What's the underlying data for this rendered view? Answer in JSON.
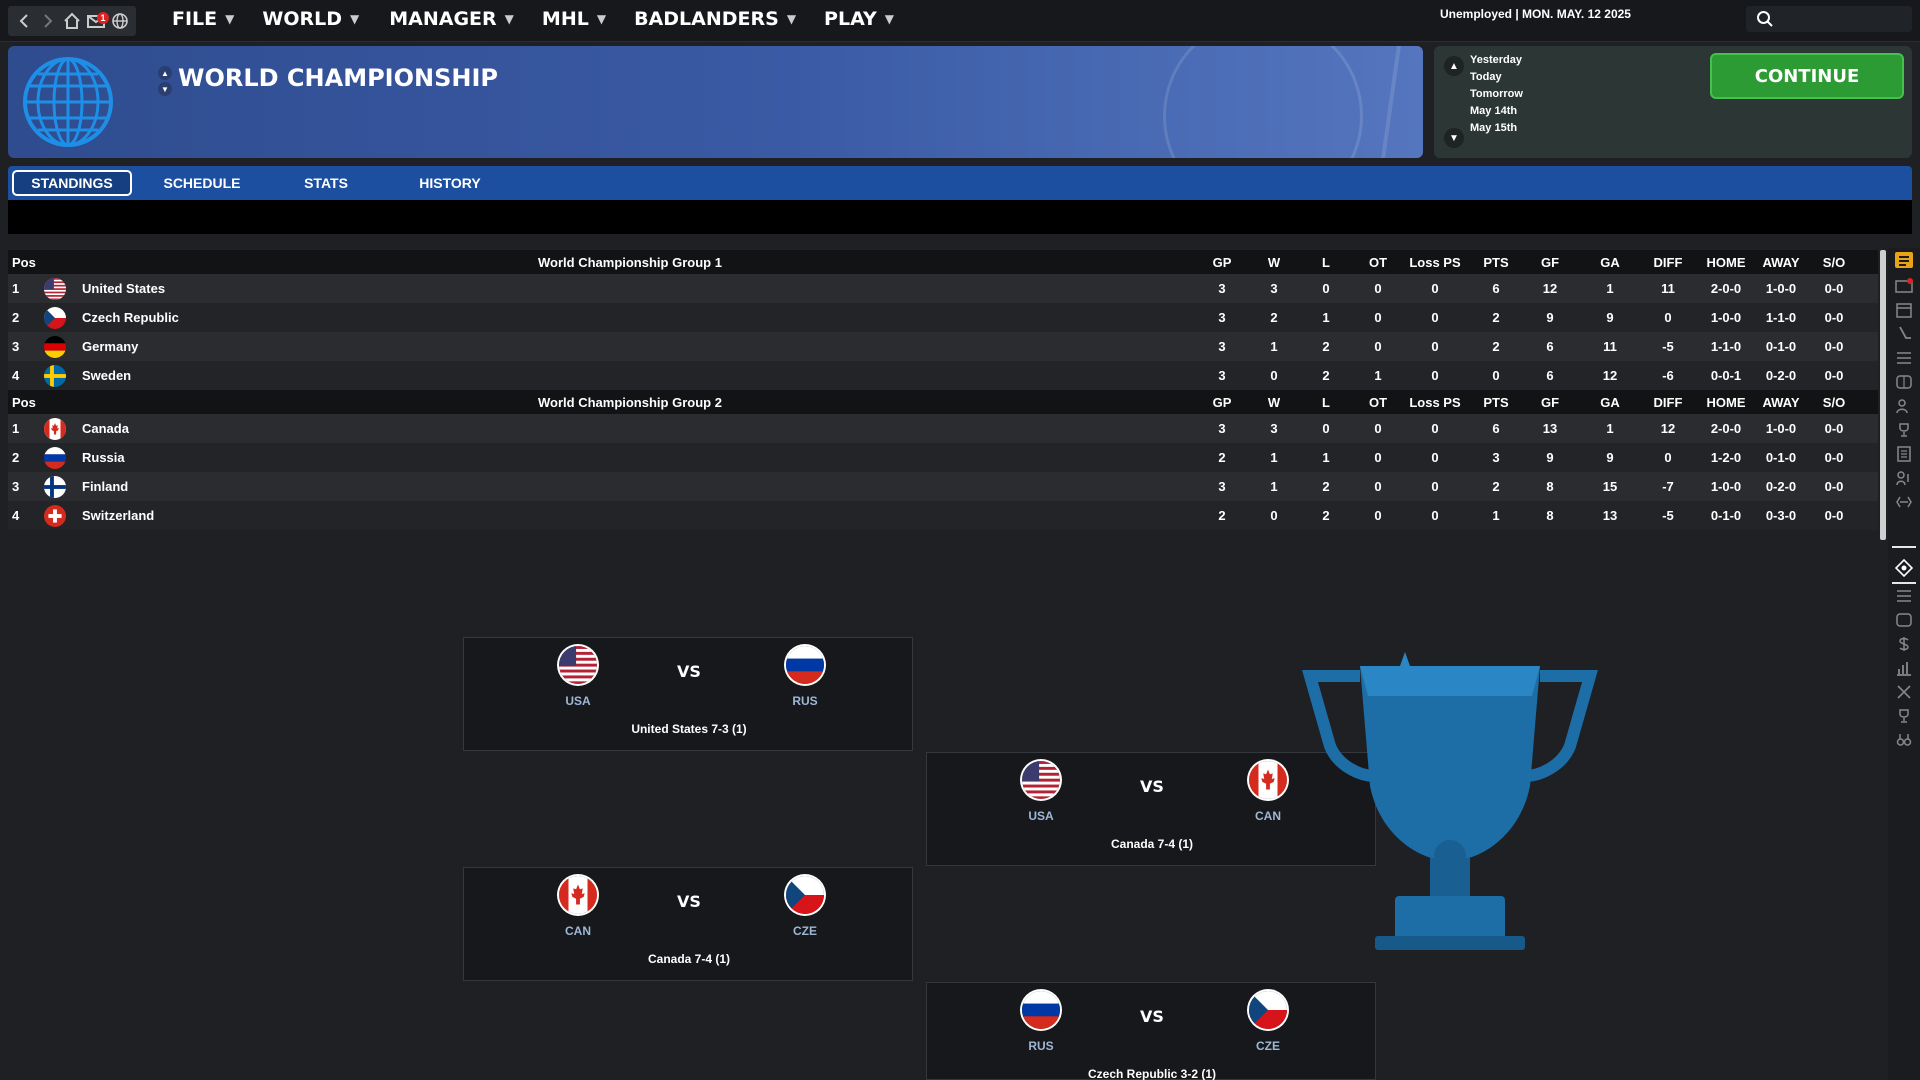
{
  "menu": [
    {
      "label": "FILE"
    },
    {
      "label": "WORLD"
    },
    {
      "label": "MANAGER"
    },
    {
      "label": "MHL"
    },
    {
      "label": "BADLANDERS"
    },
    {
      "label": "PLAY"
    }
  ],
  "status": "Unemployed | MON. MAY. 12 2025",
  "notifications": "1",
  "banner": {
    "title": "WORLD CHAMPIONSHIP"
  },
  "dates": [
    "Yesterday",
    "Today",
    "Tomorrow",
    "May 14th",
    "May 15th"
  ],
  "continue_label": "CONTINUE",
  "tabs": [
    "STANDINGS",
    "SCHEDULE",
    "STATS",
    "HISTORY"
  ],
  "columns": [
    "GP",
    "W",
    "L",
    "OT",
    "Loss PS",
    "PTS",
    "GF",
    "GA",
    "DIFF",
    "HOME",
    "AWAY",
    "S/O"
  ],
  "pos_label": "Pos",
  "groups": [
    {
      "name": "World Championship Group 1",
      "rows": [
        {
          "pos": "1",
          "flag": "usa-flag",
          "team": "United States",
          "stats": [
            "3",
            "3",
            "0",
            "0",
            "0",
            "6",
            "12",
            "1",
            "11",
            "2-0-0",
            "1-0-0",
            "0-0"
          ]
        },
        {
          "pos": "2",
          "flag": "cze-flag",
          "team": "Czech Republic",
          "stats": [
            "3",
            "2",
            "1",
            "0",
            "0",
            "2",
            "9",
            "9",
            "0",
            "1-0-0",
            "1-1-0",
            "0-0"
          ]
        },
        {
          "pos": "3",
          "flag": "ger-flag",
          "team": "Germany",
          "stats": [
            "3",
            "1",
            "2",
            "0",
            "0",
            "2",
            "6",
            "11",
            "-5",
            "1-1-0",
            "0-1-0",
            "0-0"
          ]
        },
        {
          "pos": "4",
          "flag": "swe-flag",
          "team": "Sweden",
          "stats": [
            "3",
            "0",
            "2",
            "1",
            "0",
            "0",
            "6",
            "12",
            "-6",
            "0-0-1",
            "0-2-0",
            "0-0"
          ]
        }
      ]
    },
    {
      "name": "World Championship Group 2",
      "rows": [
        {
          "pos": "1",
          "flag": "can-flag",
          "team": "Canada",
          "stats": [
            "3",
            "3",
            "0",
            "0",
            "0",
            "6",
            "13",
            "1",
            "12",
            "2-0-0",
            "1-0-0",
            "0-0"
          ]
        },
        {
          "pos": "2",
          "flag": "rus-flag",
          "team": "Russia",
          "stats": [
            "2",
            "1",
            "1",
            "0",
            "0",
            "3",
            "9",
            "9",
            "0",
            "1-2-0",
            "0-1-0",
            "0-0"
          ]
        },
        {
          "pos": "3",
          "flag": "fin-flag",
          "team": "Finland",
          "stats": [
            "3",
            "1",
            "2",
            "0",
            "0",
            "2",
            "8",
            "15",
            "-7",
            "1-0-0",
            "0-2-0",
            "0-0"
          ]
        },
        {
          "pos": "4",
          "flag": "sui-flag",
          "team": "Switzerland",
          "stats": [
            "2",
            "0",
            "2",
            "0",
            "0",
            "1",
            "8",
            "13",
            "-5",
            "0-1-0",
            "0-3-0",
            "0-0"
          ]
        }
      ]
    }
  ],
  "bracket": [
    {
      "left": "USA",
      "right": "RUS",
      "vs": "VS",
      "result": "United States 7-3 (1)"
    },
    {
      "left": "USA",
      "right": "CAN",
      "vs": "VS",
      "result": "Canada 7-4 (1)"
    },
    {
      "left": "CAN",
      "right": "CZE",
      "vs": "VS",
      "result": "Canada 7-4 (1)"
    },
    {
      "left": "RUS",
      "right": "CZE",
      "vs": "VS",
      "result": "Czech Republic 3-2 (1)"
    }
  ],
  "colors": {
    "accent": "#1c4f9f",
    "continue": "#2c9b34",
    "trophy": "#1d6da6"
  }
}
